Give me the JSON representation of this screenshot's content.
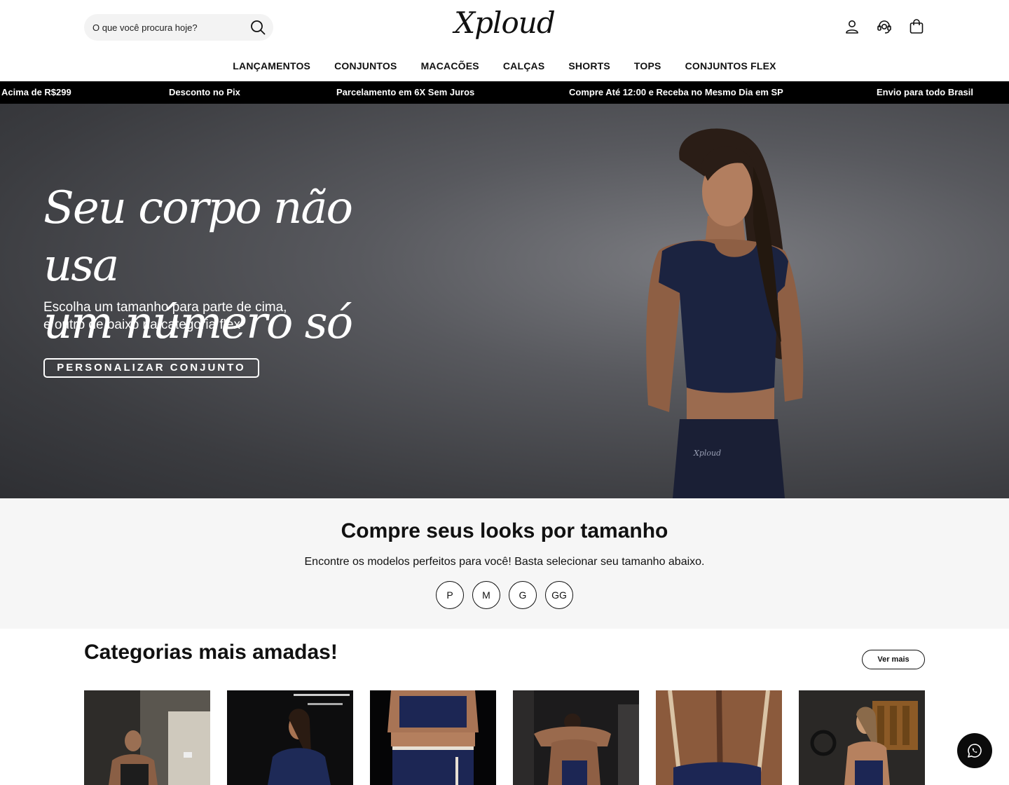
{
  "header": {
    "search_placeholder": "O que você procura hoje?",
    "logo": "Xploud",
    "icons": [
      "user-icon",
      "support-icon",
      "bag-icon"
    ]
  },
  "nav": {
    "items": [
      "LANÇAMENTOS",
      "CONJUNTOS",
      "MACACÕES",
      "CALÇAS",
      "SHORTS",
      "TOPS",
      "CONJUNTOS FLEX"
    ]
  },
  "marquee": {
    "items": [
      "Acima de R$299",
      "Desconto no Pix",
      "Parcelamento em 6X Sem Juros",
      "Compre Até 12:00 e Receba no Mesmo Dia em SP",
      "Envio para todo Brasil"
    ]
  },
  "hero": {
    "title_line1": "Seu corpo não usa",
    "title_line2": "um número só",
    "subtitle_line1": "Escolha um tamanho para parte de cima,",
    "subtitle_line2": "e outro de baixo na categoria flex",
    "cta": "PERSONALIZAR CONJUNTO",
    "garment_logo": "Xploud"
  },
  "sizes": {
    "title": "Compre seus looks por tamanho",
    "subtitle": "Encontre os modelos perfeitos para você! Basta selecionar seu tamanho abaixo.",
    "options": [
      "P",
      "M",
      "G",
      "GG"
    ]
  },
  "categories": {
    "title": "Categorias mais amadas!",
    "more_label": "Ver mais"
  },
  "colors": {
    "accent": "#000000",
    "marquee_bg": "#000000",
    "sizes_bg": "#f6f6f6",
    "outfit": "#1b2340"
  }
}
